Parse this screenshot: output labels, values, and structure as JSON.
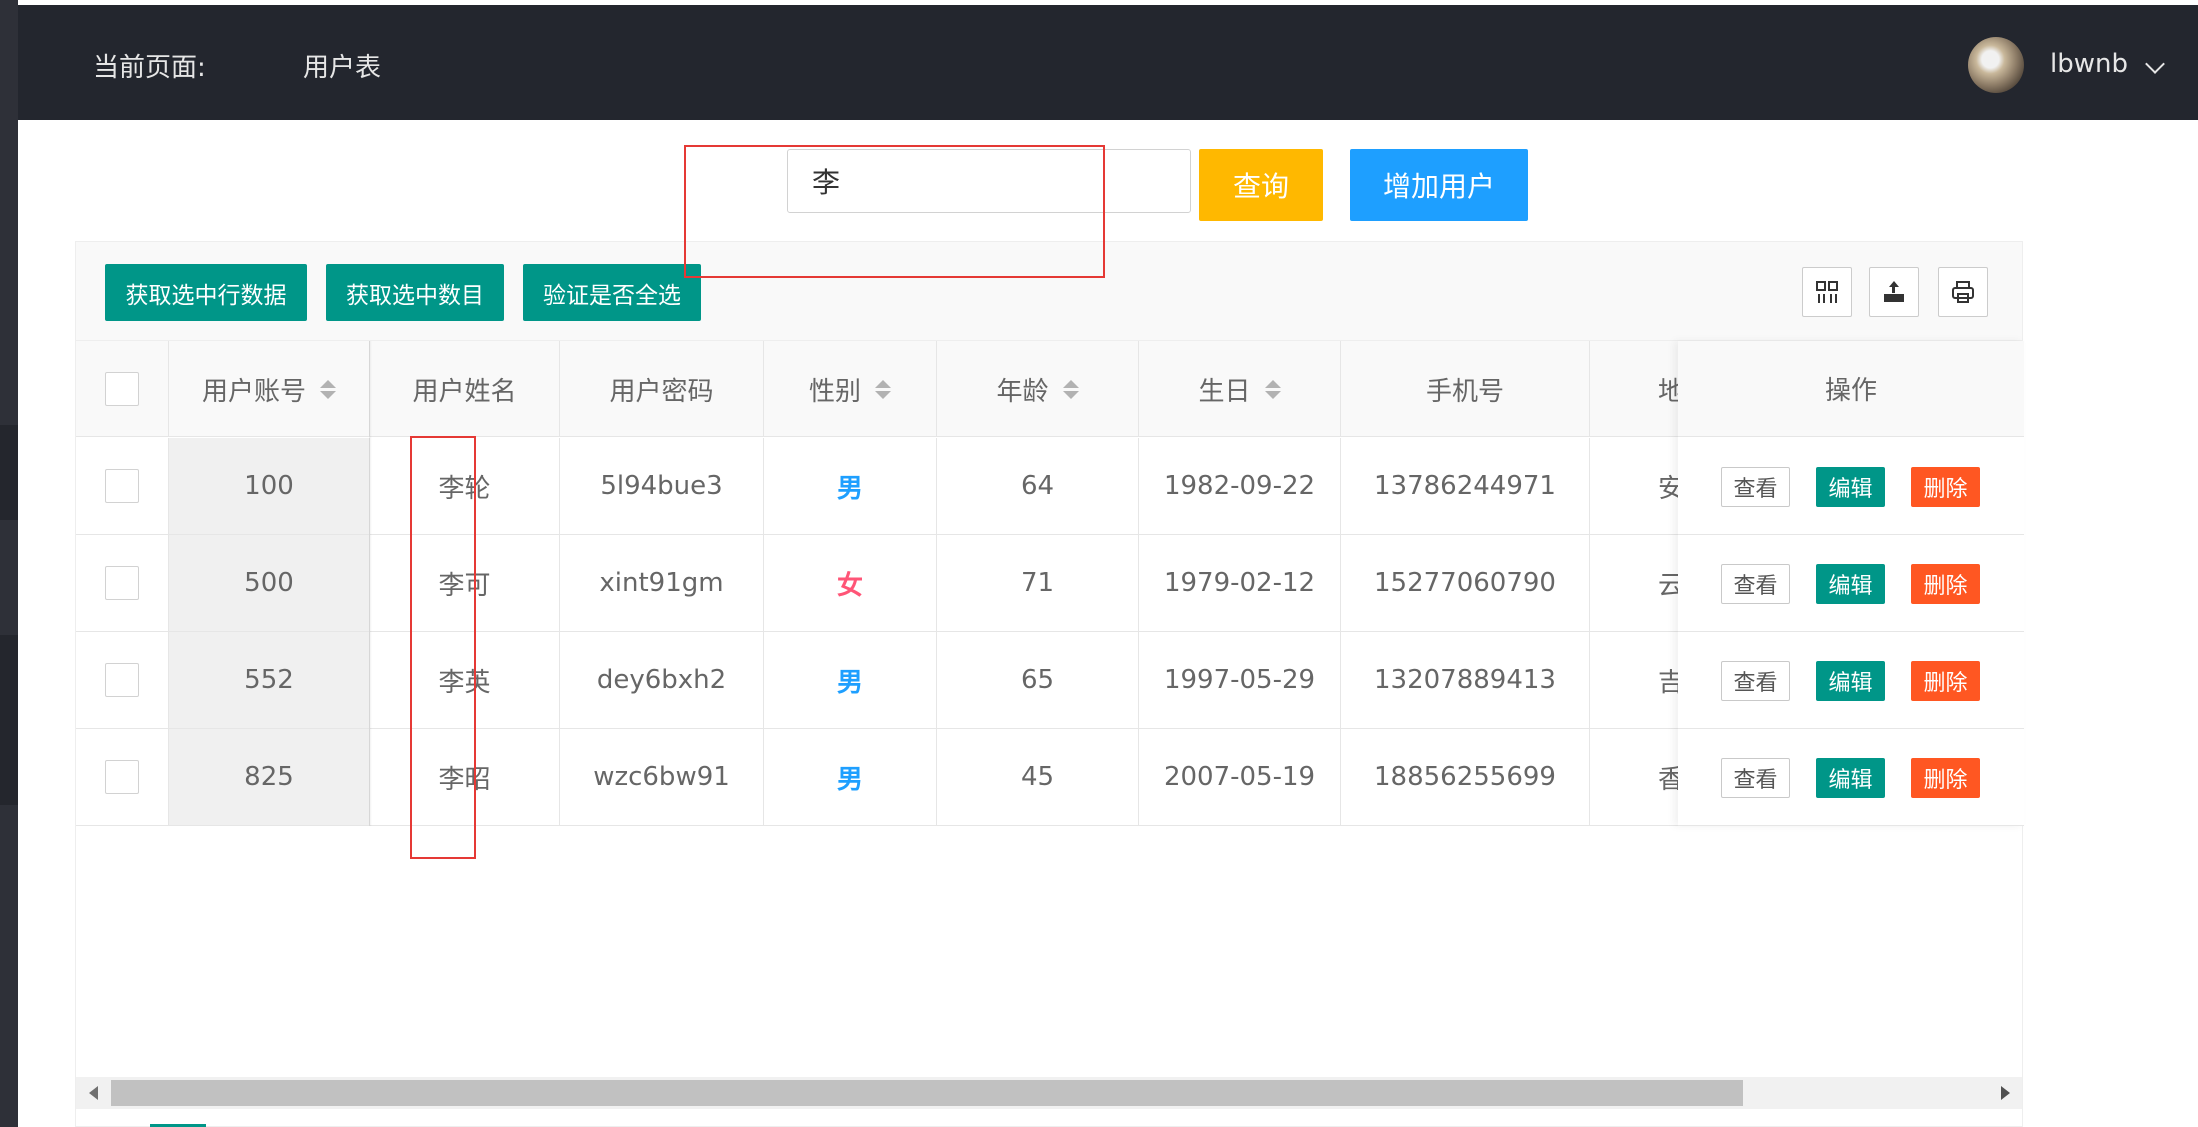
{
  "header": {
    "crumb_label": "当前页面:",
    "crumb_value": "用户表",
    "username": "lbwnb"
  },
  "search": {
    "value": "李",
    "query_label": "查询",
    "add_label": "增加用户"
  },
  "toolbar": {
    "get_rows_label": "获取选中行数据",
    "get_count_label": "获取选中数目",
    "check_all_label": "验证是否全选"
  },
  "table": {
    "columns": [
      "用户账号",
      "用户姓名",
      "用户密码",
      "性别",
      "年龄",
      "生日",
      "手机号",
      "地",
      "操作"
    ],
    "rows": [
      {
        "account": "100",
        "name": "李轮",
        "password": "5l94bue3",
        "gender": "男",
        "age": "64",
        "birthday": "1982-09-22",
        "phone": "13786244971",
        "address": "安"
      },
      {
        "account": "500",
        "name": "李可",
        "password": "xint91gm",
        "gender": "女",
        "age": "71",
        "birthday": "1979-02-12",
        "phone": "15277060790",
        "address": "云"
      },
      {
        "account": "552",
        "name": "李英",
        "password": "dey6bxh2",
        "gender": "男",
        "age": "65",
        "birthday": "1997-05-29",
        "phone": "13207889413",
        "address": "吉"
      },
      {
        "account": "825",
        "name": "李昭",
        "password": "wzc6bw91",
        "gender": "男",
        "age": "45",
        "birthday": "2007-05-19",
        "phone": "18856255699",
        "address": "香"
      }
    ],
    "actions": {
      "view": "查看",
      "edit": "编辑",
      "delete": "删除"
    }
  },
  "colors": {
    "header_bg": "#23262e",
    "primary_green": "#009688",
    "warn_yellow": "#ffb800",
    "info_blue": "#1e9fff",
    "danger_orange": "#ff5722",
    "male_color": "#1e9fff",
    "female_color": "#ff5577",
    "annotation_red": "#e53935"
  },
  "icons": [
    "user-avatar",
    "chevron-down-icon",
    "columns-filter-icon",
    "export-icon",
    "print-icon",
    "sort-icon"
  ]
}
